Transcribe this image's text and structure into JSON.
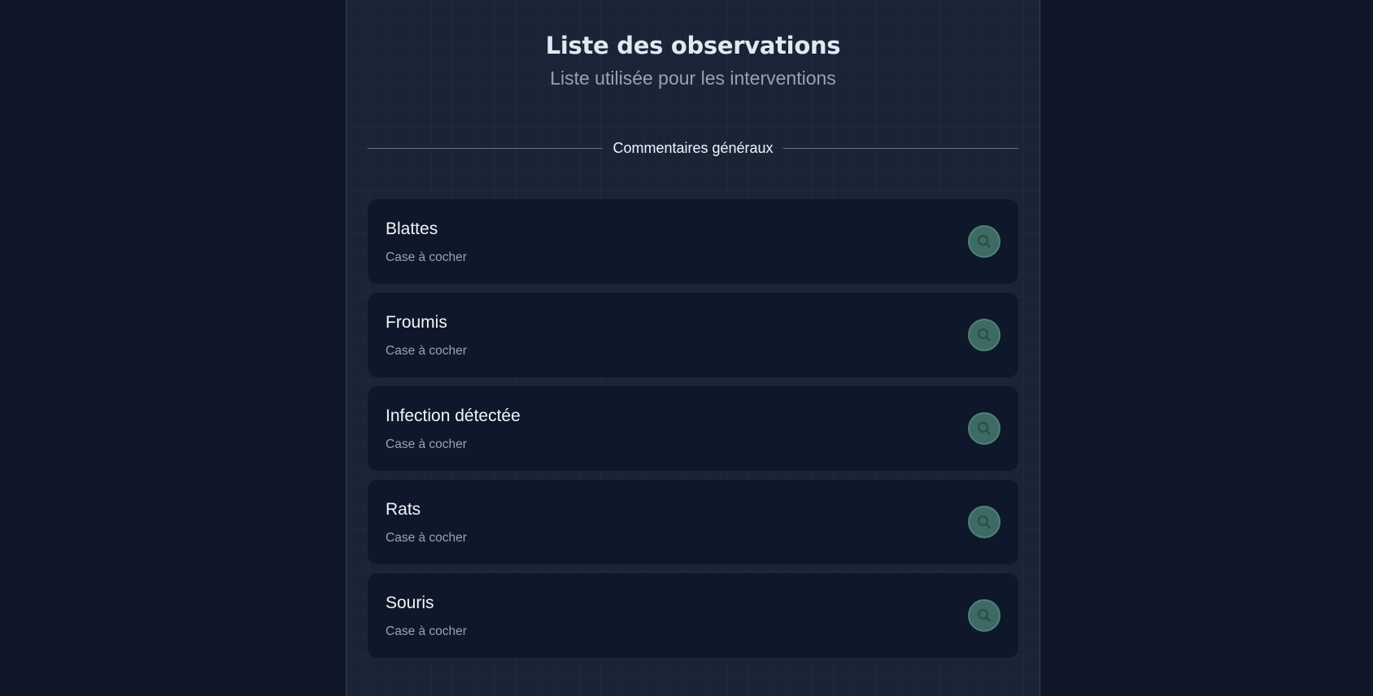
{
  "header": {
    "title": "Liste des observations",
    "subtitle": "Liste utilisée pour les interventions"
  },
  "section": {
    "label": "Commentaires généraux"
  },
  "items": [
    {
      "name": "Blattes",
      "type": "Case à cocher",
      "icon": "search-icon"
    },
    {
      "name": "Froumis",
      "type": "Case à cocher",
      "icon": "search-icon"
    },
    {
      "name": "Infection détectée",
      "type": "Case à cocher",
      "icon": "search-icon"
    },
    {
      "name": "Rats",
      "type": "Case à cocher",
      "icon": "search-icon"
    },
    {
      "name": "Souris",
      "type": "Case à cocher",
      "icon": "search-icon"
    }
  ],
  "colors": {
    "page_bg": "#0e1628",
    "panel_bg": "#1a2437",
    "card_bg": "#0f172a",
    "accent": "#3d6b63"
  }
}
